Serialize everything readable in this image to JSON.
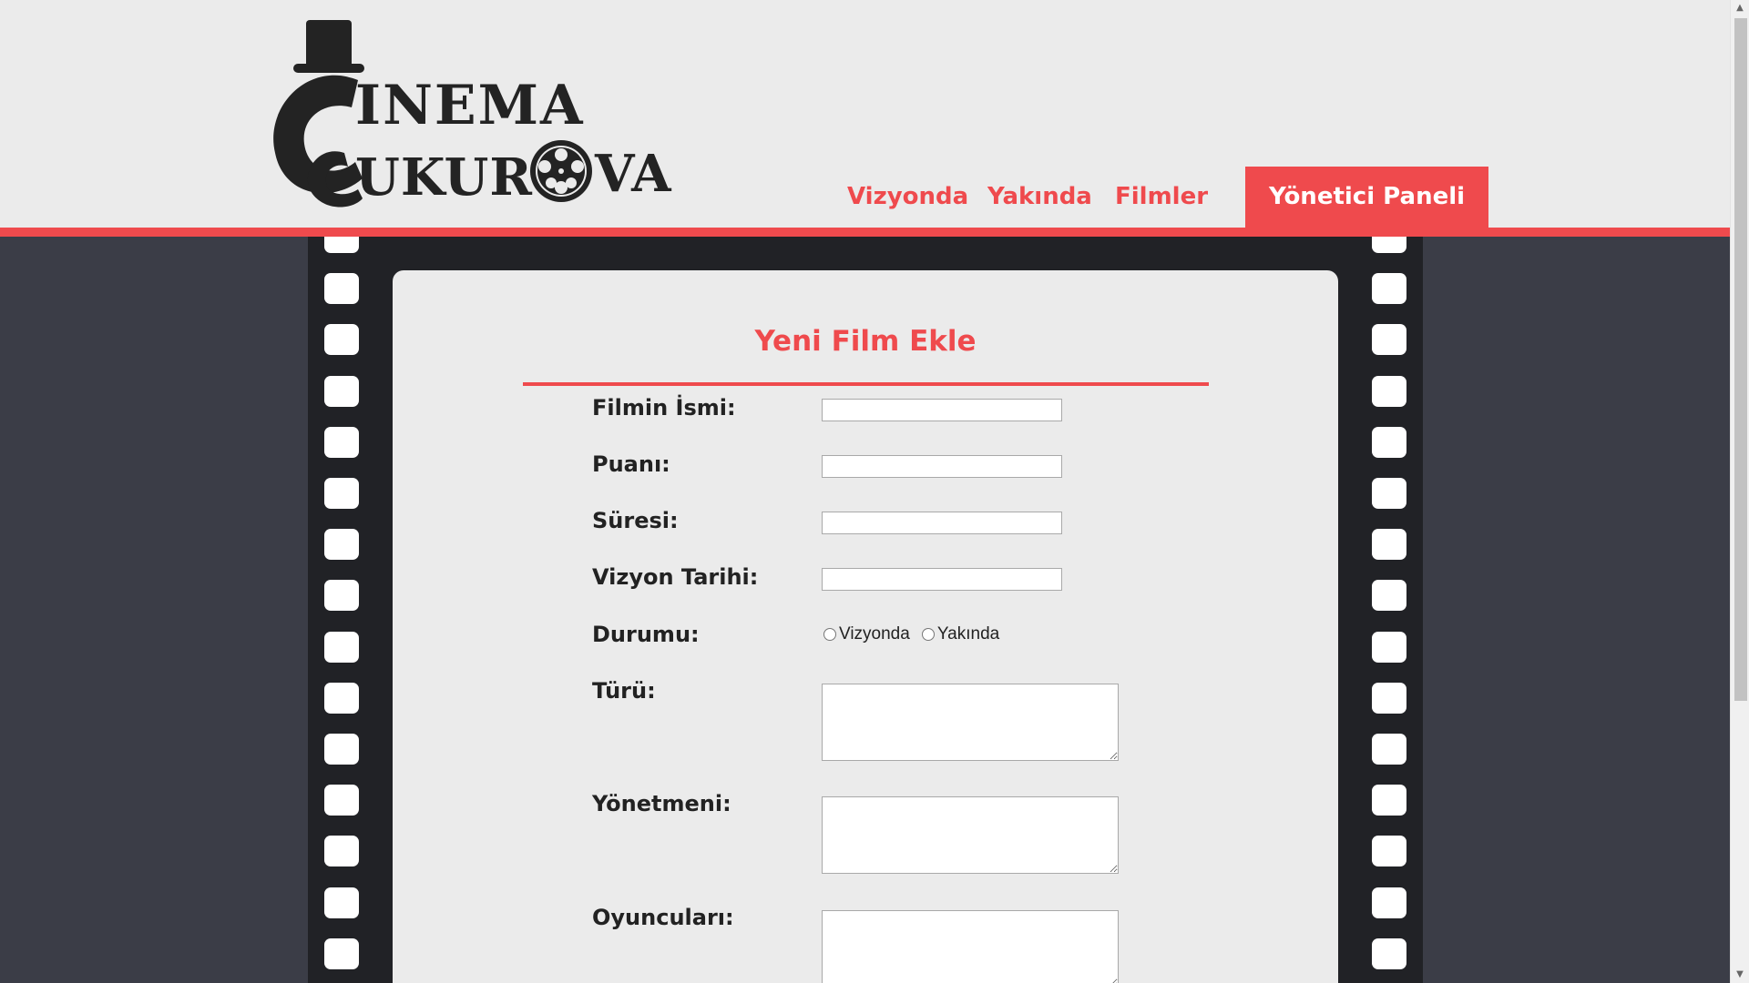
{
  "brand": {
    "logo_line1": "CINEMA",
    "logo_line2_a": "CUKUR",
    "logo_line2_b": "VA"
  },
  "nav": {
    "items": [
      {
        "label": "Vizyonda"
      },
      {
        "label": "Yakında"
      },
      {
        "label": "Filmler"
      },
      {
        "label": "Yönetici Paneli",
        "active": true
      }
    ]
  },
  "form": {
    "title": "Yeni Film Ekle",
    "fields": {
      "name": {
        "label": "Filmin İsmi:",
        "value": ""
      },
      "rating": {
        "label": "Puanı:",
        "value": ""
      },
      "duration": {
        "label": "Süresi:",
        "value": ""
      },
      "release_date": {
        "label": "Vizyon Tarihi:",
        "value": ""
      },
      "status": {
        "label": "Durumu:",
        "options": [
          "Vizyonda",
          "Yakında"
        ]
      },
      "genre": {
        "label": "Türü:",
        "value": ""
      },
      "director": {
        "label": "Yönetmeni:",
        "value": ""
      },
      "cast": {
        "label": "Oyuncuları:",
        "value": ""
      }
    }
  },
  "colors": {
    "accent": "#ef4a4d",
    "header_bg": "#ebebeb",
    "page_bg": "#3b3d47",
    "film_bg": "#212226"
  }
}
